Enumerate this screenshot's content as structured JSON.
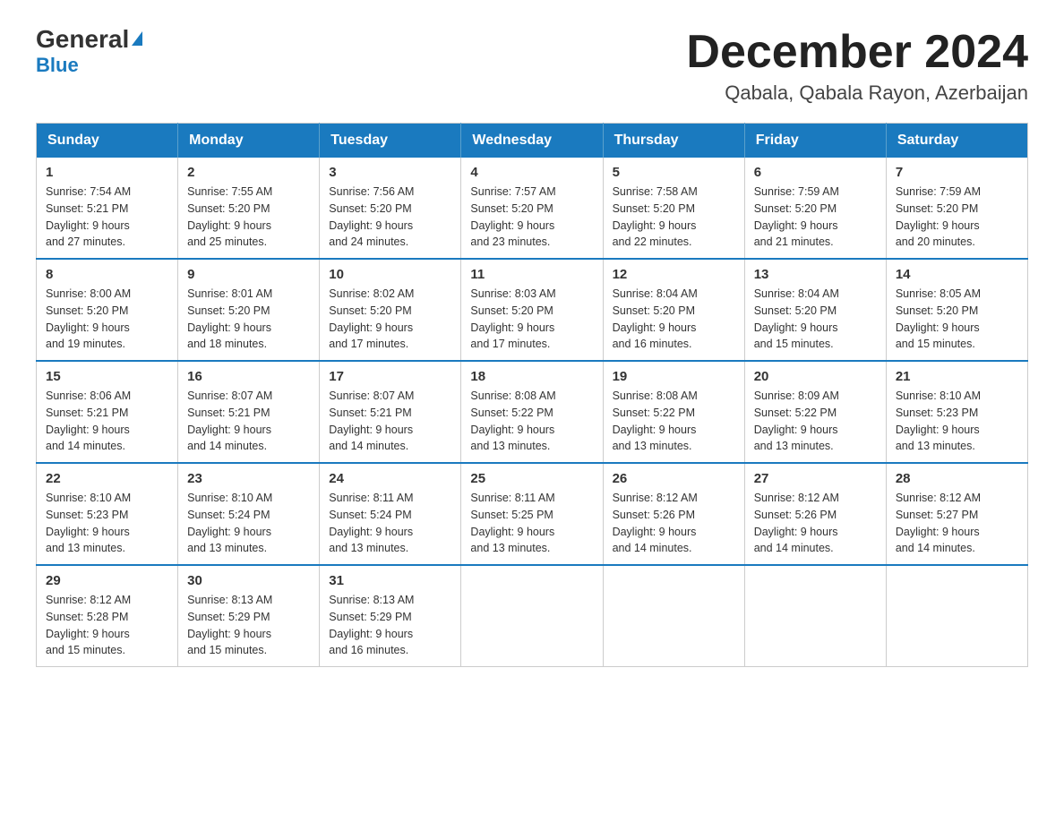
{
  "header": {
    "logo_general": "General",
    "logo_blue": "Blue",
    "month_title": "December 2024",
    "location": "Qabala, Qabala Rayon, Azerbaijan"
  },
  "weekdays": [
    "Sunday",
    "Monday",
    "Tuesday",
    "Wednesday",
    "Thursday",
    "Friday",
    "Saturday"
  ],
  "weeks": [
    [
      {
        "day": "1",
        "sunrise": "7:54 AM",
        "sunset": "5:21 PM",
        "daylight": "9 hours and 27 minutes."
      },
      {
        "day": "2",
        "sunrise": "7:55 AM",
        "sunset": "5:20 PM",
        "daylight": "9 hours and 25 minutes."
      },
      {
        "day": "3",
        "sunrise": "7:56 AM",
        "sunset": "5:20 PM",
        "daylight": "9 hours and 24 minutes."
      },
      {
        "day": "4",
        "sunrise": "7:57 AM",
        "sunset": "5:20 PM",
        "daylight": "9 hours and 23 minutes."
      },
      {
        "day": "5",
        "sunrise": "7:58 AM",
        "sunset": "5:20 PM",
        "daylight": "9 hours and 22 minutes."
      },
      {
        "day": "6",
        "sunrise": "7:59 AM",
        "sunset": "5:20 PM",
        "daylight": "9 hours and 21 minutes."
      },
      {
        "day": "7",
        "sunrise": "7:59 AM",
        "sunset": "5:20 PM",
        "daylight": "9 hours and 20 minutes."
      }
    ],
    [
      {
        "day": "8",
        "sunrise": "8:00 AM",
        "sunset": "5:20 PM",
        "daylight": "9 hours and 19 minutes."
      },
      {
        "day": "9",
        "sunrise": "8:01 AM",
        "sunset": "5:20 PM",
        "daylight": "9 hours and 18 minutes."
      },
      {
        "day": "10",
        "sunrise": "8:02 AM",
        "sunset": "5:20 PM",
        "daylight": "9 hours and 17 minutes."
      },
      {
        "day": "11",
        "sunrise": "8:03 AM",
        "sunset": "5:20 PM",
        "daylight": "9 hours and 17 minutes."
      },
      {
        "day": "12",
        "sunrise": "8:04 AM",
        "sunset": "5:20 PM",
        "daylight": "9 hours and 16 minutes."
      },
      {
        "day": "13",
        "sunrise": "8:04 AM",
        "sunset": "5:20 PM",
        "daylight": "9 hours and 15 minutes."
      },
      {
        "day": "14",
        "sunrise": "8:05 AM",
        "sunset": "5:20 PM",
        "daylight": "9 hours and 15 minutes."
      }
    ],
    [
      {
        "day": "15",
        "sunrise": "8:06 AM",
        "sunset": "5:21 PM",
        "daylight": "9 hours and 14 minutes."
      },
      {
        "day": "16",
        "sunrise": "8:07 AM",
        "sunset": "5:21 PM",
        "daylight": "9 hours and 14 minutes."
      },
      {
        "day": "17",
        "sunrise": "8:07 AM",
        "sunset": "5:21 PM",
        "daylight": "9 hours and 14 minutes."
      },
      {
        "day": "18",
        "sunrise": "8:08 AM",
        "sunset": "5:22 PM",
        "daylight": "9 hours and 13 minutes."
      },
      {
        "day": "19",
        "sunrise": "8:08 AM",
        "sunset": "5:22 PM",
        "daylight": "9 hours and 13 minutes."
      },
      {
        "day": "20",
        "sunrise": "8:09 AM",
        "sunset": "5:22 PM",
        "daylight": "9 hours and 13 minutes."
      },
      {
        "day": "21",
        "sunrise": "8:10 AM",
        "sunset": "5:23 PM",
        "daylight": "9 hours and 13 minutes."
      }
    ],
    [
      {
        "day": "22",
        "sunrise": "8:10 AM",
        "sunset": "5:23 PM",
        "daylight": "9 hours and 13 minutes."
      },
      {
        "day": "23",
        "sunrise": "8:10 AM",
        "sunset": "5:24 PM",
        "daylight": "9 hours and 13 minutes."
      },
      {
        "day": "24",
        "sunrise": "8:11 AM",
        "sunset": "5:24 PM",
        "daylight": "9 hours and 13 minutes."
      },
      {
        "day": "25",
        "sunrise": "8:11 AM",
        "sunset": "5:25 PM",
        "daylight": "9 hours and 13 minutes."
      },
      {
        "day": "26",
        "sunrise": "8:12 AM",
        "sunset": "5:26 PM",
        "daylight": "9 hours and 14 minutes."
      },
      {
        "day": "27",
        "sunrise": "8:12 AM",
        "sunset": "5:26 PM",
        "daylight": "9 hours and 14 minutes."
      },
      {
        "day": "28",
        "sunrise": "8:12 AM",
        "sunset": "5:27 PM",
        "daylight": "9 hours and 14 minutes."
      }
    ],
    [
      {
        "day": "29",
        "sunrise": "8:12 AM",
        "sunset": "5:28 PM",
        "daylight": "9 hours and 15 minutes."
      },
      {
        "day": "30",
        "sunrise": "8:13 AM",
        "sunset": "5:29 PM",
        "daylight": "9 hours and 15 minutes."
      },
      {
        "day": "31",
        "sunrise": "8:13 AM",
        "sunset": "5:29 PM",
        "daylight": "9 hours and 16 minutes."
      },
      null,
      null,
      null,
      null
    ]
  ],
  "labels": {
    "sunrise": "Sunrise:",
    "sunset": "Sunset:",
    "daylight": "Daylight:"
  }
}
